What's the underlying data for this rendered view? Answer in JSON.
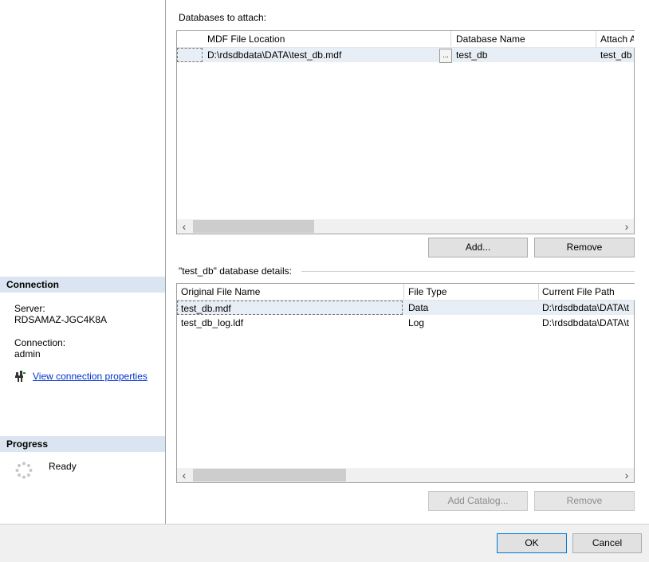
{
  "left": {
    "connection": {
      "header": "Connection",
      "server_label": "Server:",
      "server_value": "RDSAMAZ-JGC4K8A",
      "connection_label": "Connection:",
      "connection_value": "admin",
      "view_link": "View connection properties",
      "link_icon": "plug-icon"
    },
    "progress": {
      "header": "Progress",
      "status": "Ready",
      "status_icon": "spinner-icon"
    }
  },
  "attach": {
    "title": "Databases to attach:",
    "columns": [
      "MDF File Location",
      "Database Name",
      "Attach A"
    ],
    "rows": [
      {
        "location": "D:\\rdsdbdata\\DATA\\test_db.mdf",
        "browse": "...",
        "name": "test_db",
        "attach_as": "test_db"
      }
    ],
    "add_label": "Add...",
    "remove_label": "Remove"
  },
  "details": {
    "title": "\"test_db\" database details:",
    "columns": [
      "Original File Name",
      "File Type",
      "Current File Path"
    ],
    "rows": [
      {
        "file": "test_db.mdf",
        "type": "Data",
        "path": "D:\\rdsdbdata\\DATA\\t"
      },
      {
        "file": "test_db_log.ldf",
        "type": "Log",
        "path": "D:\\rdsdbdata\\DATA\\t"
      }
    ],
    "add_catalog_label": "Add Catalog...",
    "remove_label": "Remove"
  },
  "footer": {
    "ok_label": "OK",
    "cancel_label": "Cancel"
  },
  "colors": {
    "section_header_bg": "#dbe5f1",
    "link": "#0033cc",
    "selected_row": "#e8eef5",
    "focus_border": "#0078d7"
  }
}
